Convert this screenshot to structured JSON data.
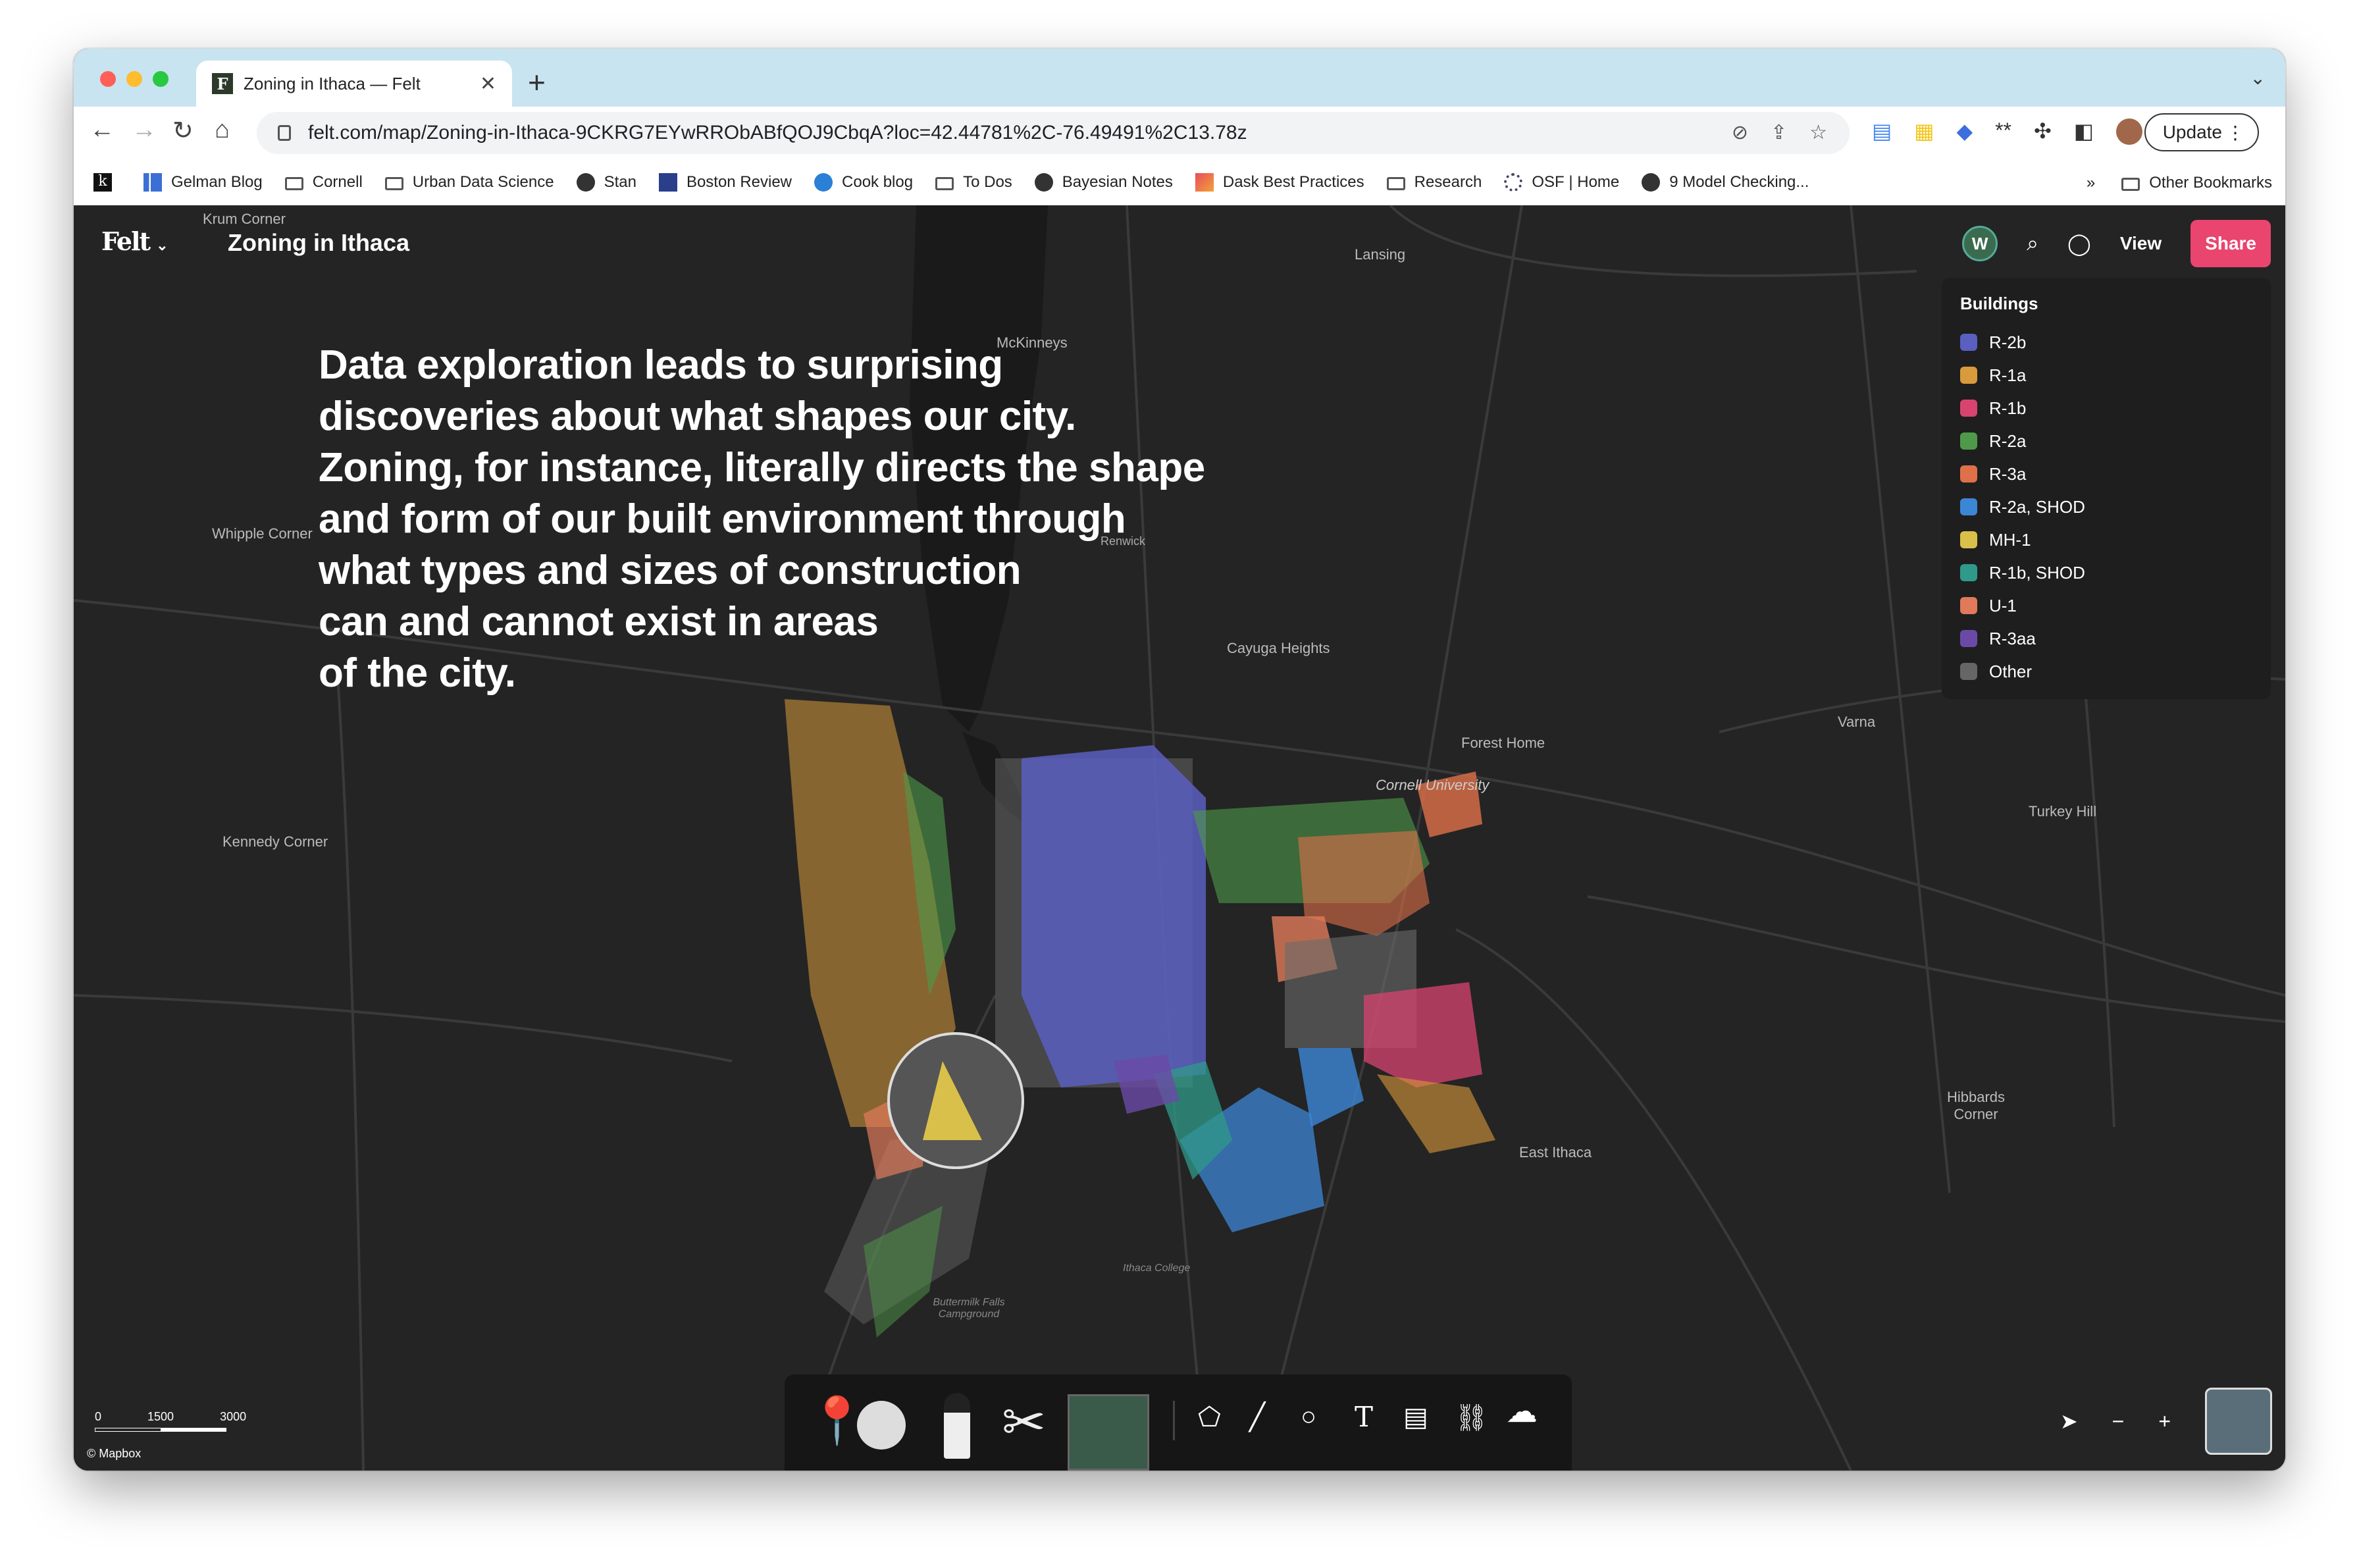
{
  "browser": {
    "tab_title": "Zoning in Ithaca — Felt",
    "tab_favicon": "F",
    "url": "felt.com/map/Zoning-in-Ithaca-9CKRG7EYwRRObABfQOJ9CbqA?loc=42.44781%2C-76.49491%2C13.78z",
    "update_label": "Update",
    "bookmarks": [
      {
        "label": "Gelman Blog"
      },
      {
        "label": "Cornell"
      },
      {
        "label": "Urban Data Science"
      },
      {
        "label": "Stan"
      },
      {
        "label": "Boston Review"
      },
      {
        "label": "Cook blog"
      },
      {
        "label": "To Dos"
      },
      {
        "label": "Bayesian Notes"
      },
      {
        "label": "Dask Best Practices"
      },
      {
        "label": "Research"
      },
      {
        "label": "OSF | Home"
      },
      {
        "label": "9 Model Checking..."
      }
    ],
    "bookmarks_overflow": "»",
    "other_bookmarks": "Other Bookmarks"
  },
  "felt": {
    "logo": "Felt",
    "map_title": "Zoning in Ithaca",
    "avatar_initial": "W",
    "view_label": "View",
    "share_label": "Share",
    "story_text": [
      "Data exploration leads to surprising",
      "discoveries about what shapes our city.",
      "Zoning, for instance, literally directs the shape",
      "and form of our built environment through",
      "what types and sizes of construction",
      "can and cannot exist in areas",
      "of the city."
    ]
  },
  "legend": {
    "title": "Buildings",
    "items": [
      {
        "label": "R-2b",
        "color": "#5b5fbf"
      },
      {
        "label": "R-1a",
        "color": "#d89a3a"
      },
      {
        "label": "R-1b",
        "color": "#d8436f"
      },
      {
        "label": "R-2a",
        "color": "#4f9a4a"
      },
      {
        "label": "R-3a",
        "color": "#e0704a"
      },
      {
        "label": "R-2a, SHOD",
        "color": "#3c86d6"
      },
      {
        "label": "MH-1",
        "color": "#d9c04a"
      },
      {
        "label": "R-1b, SHOD",
        "color": "#2f9a8a"
      },
      {
        "label": "U-1",
        "color": "#e07a5a"
      },
      {
        "label": "R-3aa",
        "color": "#6a4aa6"
      },
      {
        "label": "Other",
        "color": "#666666"
      }
    ]
  },
  "map_labels": [
    {
      "text": "Lansing"
    },
    {
      "text": "McKinneys"
    },
    {
      "text": "Whipple Corner"
    },
    {
      "text": "Kennedy Corner"
    },
    {
      "text": "Cayuga Heights"
    },
    {
      "text": "Forest Home"
    },
    {
      "text": "Cornell University"
    },
    {
      "text": "Varna"
    },
    {
      "text": "Turkey Hill"
    },
    {
      "text": "East Ithaca"
    },
    {
      "text": "Hibbards Corner"
    },
    {
      "text": "Krum Corner"
    },
    {
      "text": "Renwick"
    },
    {
      "text": "Ithaca College"
    },
    {
      "text": "Buttermilk Falls Campground"
    }
  ],
  "scale": {
    "labels": [
      "0",
      "1500",
      "3000"
    ]
  },
  "attribution": "© Mapbox",
  "tools": [
    "pin-tool",
    "route-tool",
    "marker-tool",
    "cut-tool",
    "map-layer-tool",
    "polygon-tool",
    "line-tool",
    "circle-tool",
    "text-tool",
    "note-tool",
    "link-tool",
    "upload-tool"
  ]
}
